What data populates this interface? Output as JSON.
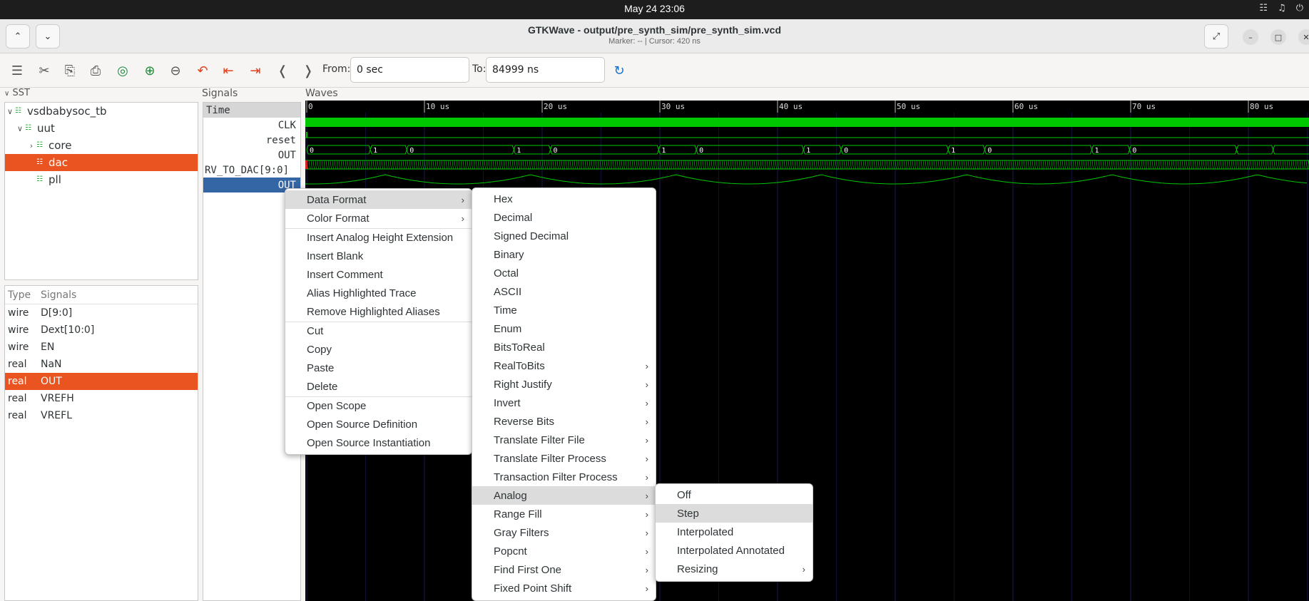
{
  "system": {
    "clock": "May 24  23:06"
  },
  "window": {
    "title": "GTKWave - output/pre_synth_sim/pre_synth_sim.vcd",
    "subtitle": "Marker: --  |  Cursor: 420 ns"
  },
  "toolbar": {
    "from_label": "From:",
    "from_value": "0 sec",
    "to_label": "To:",
    "to_value": "84999 ns"
  },
  "sst": {
    "header": "SST",
    "tree": [
      {
        "label": "vsdbabysoc_tb",
        "selected": false
      },
      {
        "label": "uut",
        "selected": false
      },
      {
        "label": "core",
        "selected": false
      },
      {
        "label": "dac",
        "selected": true
      },
      {
        "label": "pll",
        "selected": false
      }
    ],
    "list_headers": {
      "type": "Type",
      "signals": "Signals"
    },
    "list": [
      {
        "type": "wire",
        "name": "D[9:0]",
        "selected": false
      },
      {
        "type": "wire",
        "name": "Dext[10:0]",
        "selected": false
      },
      {
        "type": "wire",
        "name": "EN",
        "selected": false
      },
      {
        "type": "real",
        "name": "NaN",
        "selected": false
      },
      {
        "type": "real",
        "name": "OUT",
        "selected": true
      },
      {
        "type": "real",
        "name": "VREFH",
        "selected": false
      },
      {
        "type": "real",
        "name": "VREFL",
        "selected": false
      }
    ]
  },
  "signals_pane": {
    "header": "Signals",
    "time_label": "Time",
    "rows": [
      "CLK",
      "reset",
      "OUT",
      "RV_TO_DAC[9:0]",
      "OUT"
    ]
  },
  "waves_pane": {
    "header": "Waves",
    "ticks": [
      "0",
      "10 us",
      "20 us",
      "30 us",
      "40 us",
      "50 us",
      "60 us",
      "70 us",
      "80 us"
    ],
    "out_values": [
      "0",
      "1",
      "0",
      "1",
      "0",
      "1",
      "0",
      "1",
      "0",
      "1",
      "0",
      "1",
      "0"
    ]
  },
  "context_menu": {
    "items": [
      {
        "label": "Data Format",
        "submenu": true,
        "highlighted": true
      },
      {
        "label": "Color Format",
        "submenu": true,
        "highlighted": false
      },
      {
        "label": "Insert Analog Height Extension",
        "submenu": false,
        "highlighted": false
      },
      {
        "label": "Insert Blank",
        "submenu": false,
        "highlighted": false
      },
      {
        "label": "Insert Comment",
        "submenu": false,
        "highlighted": false
      },
      {
        "label": "Alias Highlighted Trace",
        "submenu": false,
        "highlighted": false
      },
      {
        "label": "Remove Highlighted Aliases",
        "submenu": false,
        "highlighted": false
      },
      {
        "label": "Cut",
        "submenu": false,
        "highlighted": false
      },
      {
        "label": "Copy",
        "submenu": false,
        "highlighted": false
      },
      {
        "label": "Paste",
        "submenu": false,
        "highlighted": false
      },
      {
        "label": "Delete",
        "submenu": false,
        "highlighted": false
      },
      {
        "label": "Open Scope",
        "submenu": false,
        "highlighted": false
      },
      {
        "label": "Open Source Definition",
        "submenu": false,
        "highlighted": false
      },
      {
        "label": "Open Source Instantiation",
        "submenu": false,
        "highlighted": false
      }
    ]
  },
  "data_format_menu": {
    "items": [
      {
        "label": "Hex",
        "submenu": false,
        "highlighted": false
      },
      {
        "label": "Decimal",
        "submenu": false,
        "highlighted": false
      },
      {
        "label": "Signed Decimal",
        "submenu": false,
        "highlighted": false
      },
      {
        "label": "Binary",
        "submenu": false,
        "highlighted": false
      },
      {
        "label": "Octal",
        "submenu": false,
        "highlighted": false
      },
      {
        "label": "ASCII",
        "submenu": false,
        "highlighted": false
      },
      {
        "label": "Time",
        "submenu": false,
        "highlighted": false
      },
      {
        "label": "Enum",
        "submenu": false,
        "highlighted": false
      },
      {
        "label": "BitsToReal",
        "submenu": false,
        "highlighted": false
      },
      {
        "label": "RealToBits",
        "submenu": true,
        "highlighted": false
      },
      {
        "label": "Right Justify",
        "submenu": true,
        "highlighted": false
      },
      {
        "label": "Invert",
        "submenu": true,
        "highlighted": false
      },
      {
        "label": "Reverse Bits",
        "submenu": true,
        "highlighted": false
      },
      {
        "label": "Translate Filter File",
        "submenu": true,
        "highlighted": false
      },
      {
        "label": "Translate Filter Process",
        "submenu": true,
        "highlighted": false
      },
      {
        "label": "Transaction Filter Process",
        "submenu": true,
        "highlighted": false
      },
      {
        "label": "Analog",
        "submenu": true,
        "highlighted": true
      },
      {
        "label": "Range Fill",
        "submenu": true,
        "highlighted": false
      },
      {
        "label": "Gray Filters",
        "submenu": true,
        "highlighted": false
      },
      {
        "label": "Popcnt",
        "submenu": true,
        "highlighted": false
      },
      {
        "label": "Find First One",
        "submenu": true,
        "highlighted": false
      },
      {
        "label": "Fixed Point Shift",
        "submenu": true,
        "highlighted": false
      }
    ]
  },
  "analog_menu": {
    "items": [
      {
        "label": "Off",
        "submenu": false,
        "highlighted": false
      },
      {
        "label": "Step",
        "submenu": false,
        "highlighted": true
      },
      {
        "label": "Interpolated",
        "submenu": false,
        "highlighted": false
      },
      {
        "label": "Interpolated Annotated",
        "submenu": false,
        "highlighted": false
      },
      {
        "label": "Resizing",
        "submenu": true,
        "highlighted": false
      }
    ]
  },
  "colors": {
    "accent": "#e95420",
    "wave": "#00c800",
    "selection_blue": "#3465a4"
  }
}
